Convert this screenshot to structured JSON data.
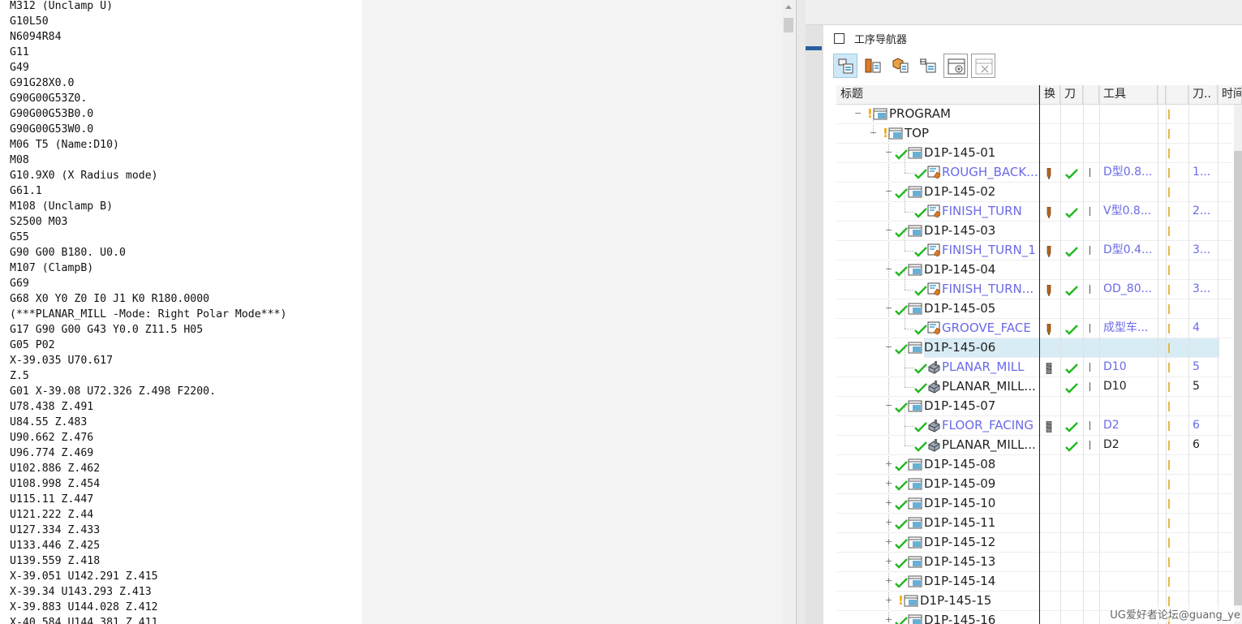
{
  "editor": {
    "lines": [
      "M312 (Unclamp U)",
      "G10L50",
      "N6094R84",
      "G11",
      "G49",
      "G91G28X0.0",
      "G90G00G53Z0.",
      "G90G00G53B0.0",
      "G90G00G53W0.0",
      "M06 T5 (Name:D10)",
      "M08",
      "G10.9X0 (X Radius mode)",
      "G61.1",
      "M108 (Unclamp B)",
      "S2500 M03",
      "G55",
      "G90 G00 B180. U0.0",
      "M107 (ClampB)",
      "G69",
      "G68 X0 Y0 Z0 I0 J1 K0 R180.0000",
      "(***PLANAR_MILL -Mode: Right Polar Mode***)",
      "G17 G90 G00 G43 Y0.0 Z11.5 H05",
      "G05 P02",
      "X-39.035 U70.617",
      "Z.5",
      "G01 X-39.08 U72.326 Z.498 F2200.",
      "U78.438 Z.491",
      "U84.55 Z.483",
      "U90.662 Z.476",
      "U96.774 Z.469",
      "U102.886 Z.462",
      "U108.998 Z.454",
      "U115.11 Z.447",
      "U121.222 Z.44",
      "U127.334 Z.433",
      "U133.446 Z.425",
      "U139.559 Z.418",
      "X-39.051 U142.291 Z.415",
      "X-39.34 U143.293 Z.413",
      "X-39.883 U144.028 Z.412",
      "X-40.584 U144.381 Z.411"
    ]
  },
  "navigator": {
    "title": "工序导航器",
    "toolbar": [
      {
        "icon": "program-order-view-icon",
        "active": true
      },
      {
        "icon": "machine-tool-view-icon",
        "active": false
      },
      {
        "icon": "geometry-view-icon",
        "active": false
      },
      {
        "icon": "machining-method-view-icon",
        "active": false
      },
      {
        "icon": "add-column-icon",
        "active": false
      },
      {
        "icon": "remove-column-icon",
        "active": false
      }
    ],
    "columns": {
      "name": "标题",
      "change": "换",
      "toolpath": "刀",
      "tool": "工具",
      "toolnum": "刀..",
      "time": "时间"
    },
    "rows": [
      {
        "name": "PROGRAM",
        "level": 0,
        "type": "folder",
        "expander": "−",
        "status": "excl",
        "color": "black"
      },
      {
        "name": "TOP",
        "level": 1,
        "type": "folder",
        "expander": "−",
        "status": "excl",
        "color": "black"
      },
      {
        "name": "D1P-145-01",
        "level": 2,
        "type": "folder",
        "expander": "−",
        "status": "check",
        "color": "black"
      },
      {
        "name": "ROUGH_BACK...",
        "level": 3,
        "type": "turn",
        "status": "check",
        "color": "blue",
        "tool_icon": "turn",
        "path_ok": true,
        "tool": "D型0.8...",
        "toolnum": "1...",
        "tool_color": "blue"
      },
      {
        "name": "D1P-145-02",
        "level": 2,
        "type": "folder",
        "expander": "−",
        "status": "check",
        "color": "black"
      },
      {
        "name": "FINISH_TURN",
        "level": 3,
        "type": "turn",
        "status": "check",
        "color": "blue",
        "tool_icon": "turn",
        "path_ok": true,
        "tool": "V型0.8...",
        "toolnum": "2...",
        "tool_color": "blue"
      },
      {
        "name": "D1P-145-03",
        "level": 2,
        "type": "folder",
        "expander": "−",
        "status": "check",
        "color": "black"
      },
      {
        "name": "FINISH_TURN_1",
        "level": 3,
        "type": "turn",
        "status": "check",
        "color": "blue",
        "tool_icon": "turn",
        "path_ok": true,
        "tool": "D型0.4...",
        "toolnum": "3...",
        "tool_color": "blue"
      },
      {
        "name": "D1P-145-04",
        "level": 2,
        "type": "folder",
        "expander": "−",
        "status": "check",
        "color": "black"
      },
      {
        "name": "FINISH_TURN...",
        "level": 3,
        "type": "turn",
        "status": "check",
        "color": "blue",
        "tool_icon": "turn",
        "path_ok": true,
        "tool": "OD_80...",
        "toolnum": "3...",
        "tool_color": "blue"
      },
      {
        "name": "D1P-145-05",
        "level": 2,
        "type": "folder",
        "expander": "−",
        "status": "check",
        "color": "black"
      },
      {
        "name": "GROOVE_FACE",
        "level": 3,
        "type": "turn",
        "status": "check",
        "color": "blue",
        "tool_icon": "turn",
        "path_ok": true,
        "tool": "成型车...",
        "toolnum": "4",
        "tool_color": "blue"
      },
      {
        "name": "D1P-145-06",
        "level": 2,
        "type": "folder",
        "expander": "−",
        "status": "check",
        "color": "black",
        "selected": true
      },
      {
        "name": "PLANAR_MILL",
        "level": 3,
        "type": "mill",
        "status": "check",
        "color": "blue",
        "tool_icon": "mill",
        "path_ok": true,
        "tool": "D10",
        "toolnum": "5",
        "tool_color": "blue"
      },
      {
        "name": "PLANAR_MILL...",
        "level": 3,
        "type": "mill",
        "status": "check",
        "color": "black",
        "tool_icon": "",
        "path_ok": true,
        "tool": "D10",
        "toolnum": "5",
        "tool_color": "black"
      },
      {
        "name": "D1P-145-07",
        "level": 2,
        "type": "folder",
        "expander": "−",
        "status": "check",
        "color": "black"
      },
      {
        "name": "FLOOR_FACING",
        "level": 3,
        "type": "mill",
        "status": "check",
        "color": "blue",
        "tool_icon": "mill",
        "path_ok": true,
        "tool": "D2",
        "toolnum": "6",
        "tool_color": "blue"
      },
      {
        "name": "PLANAR_MILL...",
        "level": 3,
        "type": "mill",
        "status": "check",
        "color": "black",
        "tool_icon": "",
        "path_ok": true,
        "tool": "D2",
        "toolnum": "6",
        "tool_color": "black"
      },
      {
        "name": "D1P-145-08",
        "level": 2,
        "type": "folder",
        "expander": "+",
        "status": "check",
        "color": "black"
      },
      {
        "name": "D1P-145-09",
        "level": 2,
        "type": "folder",
        "expander": "+",
        "status": "check",
        "color": "black"
      },
      {
        "name": "D1P-145-10",
        "level": 2,
        "type": "folder",
        "expander": "+",
        "status": "check",
        "color": "black"
      },
      {
        "name": "D1P-145-11",
        "level": 2,
        "type": "folder",
        "expander": "+",
        "status": "check",
        "color": "black"
      },
      {
        "name": "D1P-145-12",
        "level": 2,
        "type": "folder",
        "expander": "+",
        "status": "check",
        "color": "black"
      },
      {
        "name": "D1P-145-13",
        "level": 2,
        "type": "folder",
        "expander": "+",
        "status": "check",
        "color": "black"
      },
      {
        "name": "D1P-145-14",
        "level": 2,
        "type": "folder",
        "expander": "+",
        "status": "check",
        "color": "black"
      },
      {
        "name": "D1P-145-15",
        "level": 2,
        "type": "folder",
        "expander": "+",
        "status": "excl",
        "color": "black"
      },
      {
        "name": "D1P-145-16",
        "level": 2,
        "type": "folder",
        "expander": "+",
        "status": "check",
        "color": "black"
      }
    ]
  },
  "watermark": "UG爱好者论坛@guang_ye",
  "colors": {
    "check": "#22b822",
    "excl": "#f2a900",
    "blue_text": "#6a6ae8",
    "selected_row": "#d8ecf5",
    "folder": "#2a8fc4"
  }
}
